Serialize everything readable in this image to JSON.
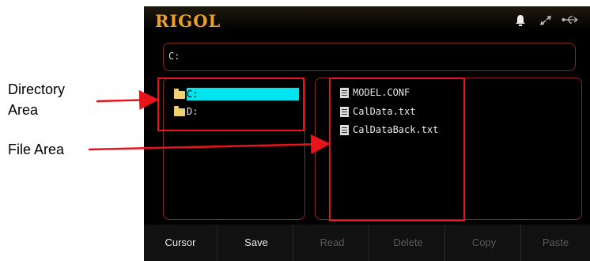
{
  "header": {
    "logo": "RIGOL"
  },
  "status_icons": [
    "bell-icon",
    "arrows-icon",
    "usb-icon"
  ],
  "path_bar": {
    "value": "C:"
  },
  "directory_area": {
    "items": [
      {
        "label": "C:",
        "icon": "folder-icon",
        "selected": true
      },
      {
        "label": "D:",
        "icon": "folder-icon",
        "selected": false
      }
    ]
  },
  "file_area": {
    "items": [
      {
        "label": "MODEL.CONF",
        "icon": "file-icon"
      },
      {
        "label": "CalData.txt",
        "icon": "file-icon"
      },
      {
        "label": "CalDataBack.txt",
        "icon": "file-icon"
      }
    ]
  },
  "softkeys": [
    {
      "label": "Cursor",
      "enabled": true
    },
    {
      "label": "Save",
      "enabled": true
    },
    {
      "label": "Read",
      "enabled": false
    },
    {
      "label": "Delete",
      "enabled": false
    },
    {
      "label": "Copy",
      "enabled": false
    },
    {
      "label": "Paste",
      "enabled": false
    }
  ],
  "annotations": {
    "directory_label_line1": "Directory",
    "directory_label_line2": "Area",
    "file_label": "File Area"
  },
  "colors": {
    "accent": "#f0a020",
    "selection": "#00e5f0",
    "callout": "#e8141c",
    "border": "#8a2a14"
  }
}
